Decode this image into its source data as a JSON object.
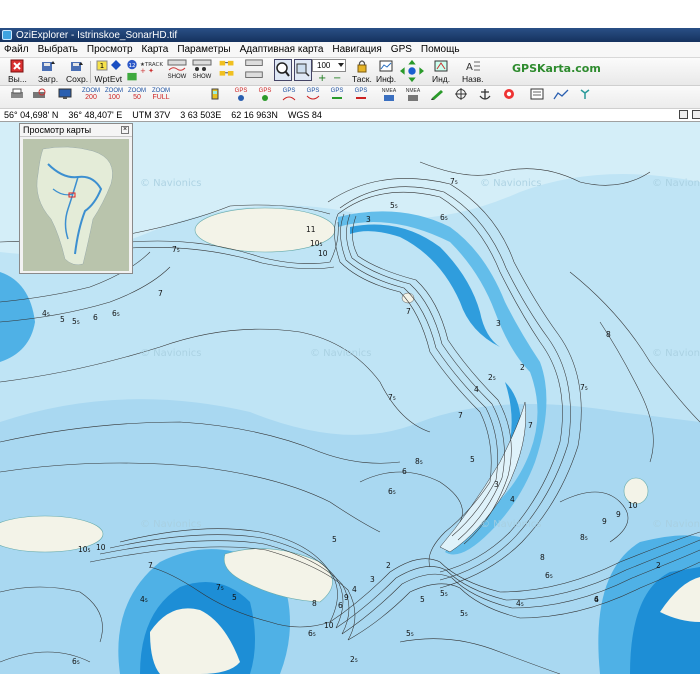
{
  "window": {
    "title": "OziExplorer - Istrinskoe_SonarHD.tif"
  },
  "menu": [
    "Файл",
    "Выбрать",
    "Просмотр",
    "Карта",
    "Параметры",
    "Адаптивная карта",
    "Навигация",
    "GPS",
    "Помощь"
  ],
  "toolbar1": {
    "exit_label": "Вы...",
    "load_label": "Загр.",
    "save_label": "Сохр.",
    "wpt_label": "Wpt",
    "evt_label": "Evt",
    "track_label": "TRACK",
    "show_label": "SHOW",
    "zoom_value": "100",
    "task_label": "Таск.",
    "info_label": "Инф.",
    "ind_label": "Инд.",
    "nav_label": "Назв.",
    "brand": "GPSKarta.com"
  },
  "toolbar2": {
    "zoom_buttons": [
      {
        "top": "ZOOM",
        "bottom": "200"
      },
      {
        "top": "ZOOM",
        "bottom": "100"
      },
      {
        "top": "ZOOM",
        "bottom": "50"
      },
      {
        "top": "ZOOM",
        "bottom": "FULL"
      }
    ],
    "gps_label": "GPS",
    "nmea_label": "NMEA"
  },
  "coords": {
    "lat": "56° 04,698' N",
    "lon": "36° 48,407' E",
    "utm": "UTM 37V",
    "easting": "3 63 503E",
    "northing": "62 16 963N",
    "datum": "WGS 84"
  },
  "overview": {
    "title": "Просмотр карты"
  },
  "map": {
    "watermark": "© Navionics",
    "depth_labels": [
      "7₅",
      "5₅",
      "6₅",
      "3",
      "11",
      "10₅",
      "10",
      "7₅",
      "7",
      "4₅",
      "5",
      "5₅",
      "6",
      "6₅",
      "7",
      "2₅",
      "3",
      "4",
      "2",
      "7₅",
      "8",
      "7₅",
      "7",
      "5",
      "6",
      "6₅",
      "8₅",
      "7",
      "3",
      "4",
      "5₅",
      "10",
      "9",
      "8₅",
      "9",
      "8",
      "6₅",
      "2",
      "6",
      "10₅",
      "10",
      "7",
      "4₅",
      "7₅",
      "5",
      "6",
      "10",
      "8",
      "9",
      "3",
      "2",
      "4",
      "5",
      "6₅",
      "5₅",
      "5",
      "4₅",
      "2₅",
      "6₅",
      "5₅",
      "4"
    ]
  },
  "colors": {
    "deep": "#1d8ed6",
    "mid": "#4fb1e6",
    "shallow": "#8fd0f0",
    "pale": "#bfe4f5",
    "land": "#f3f3e8",
    "brand_green": "#2e8b2e"
  }
}
